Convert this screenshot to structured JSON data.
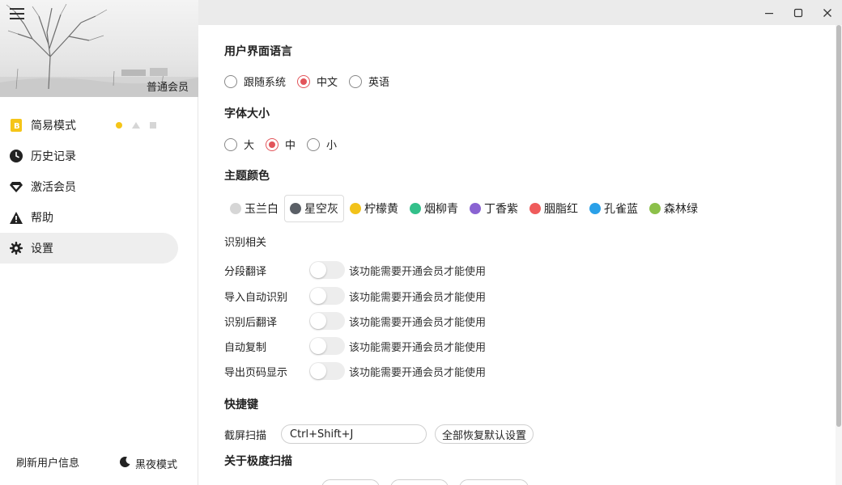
{
  "sidebar": {
    "member_label": "普通会员",
    "items": [
      {
        "label": "简易模式",
        "icon": "b-badge-icon"
      },
      {
        "label": "历史记录",
        "icon": "clock-icon"
      },
      {
        "label": "激活会员",
        "icon": "diamond-icon"
      },
      {
        "label": "帮助",
        "icon": "warning-icon"
      },
      {
        "label": "设置",
        "icon": "gear-icon"
      }
    ],
    "refresh_label": "刷新用户信息",
    "dark_mode_label": "黑夜模式"
  },
  "settings": {
    "language": {
      "title": "用户界面语言",
      "options": [
        "跟随系统",
        "中文",
        "英语"
      ],
      "selected": "中文"
    },
    "font_size": {
      "title": "字体大小",
      "options": [
        "大",
        "中",
        "小"
      ],
      "selected": "中"
    },
    "theme": {
      "title": "主题颜色",
      "options": [
        {
          "label": "玉兰白",
          "color": "#d6d6d6"
        },
        {
          "label": "星空灰",
          "color": "#5a5f66"
        },
        {
          "label": "柠檬黄",
          "color": "#f2c21a"
        },
        {
          "label": "烟柳青",
          "color": "#33c08a"
        },
        {
          "label": "丁香紫",
          "color": "#8a63d2"
        },
        {
          "label": "胭脂红",
          "color": "#ef5b5b"
        },
        {
          "label": "孔雀蓝",
          "color": "#2aa0e8"
        },
        {
          "label": "森林绿",
          "color": "#8cc04a"
        }
      ],
      "selected": "星空灰"
    },
    "recognition": {
      "title": "识别相关",
      "items": [
        {
          "label": "分段翻译",
          "note": "该功能需要开通会员才能使用"
        },
        {
          "label": "导入自动识别",
          "note": "该功能需要开通会员才能使用"
        },
        {
          "label": "识别后翻译",
          "note": "该功能需要开通会员才能使用"
        },
        {
          "label": "自动复制",
          "note": "该功能需要开通会员才能使用"
        },
        {
          "label": "导出页码显示",
          "note": "该功能需要开通会员才能使用"
        }
      ]
    },
    "shortcuts": {
      "title": "快捷键",
      "screenshot_label": "截屏扫描",
      "screenshot_value": "Ctrl+Shift+J",
      "reset_label": "全部恢复默认设置"
    },
    "about": {
      "title": "关于极度扫描"
    }
  },
  "colors": {
    "accent": "#e2545a"
  }
}
